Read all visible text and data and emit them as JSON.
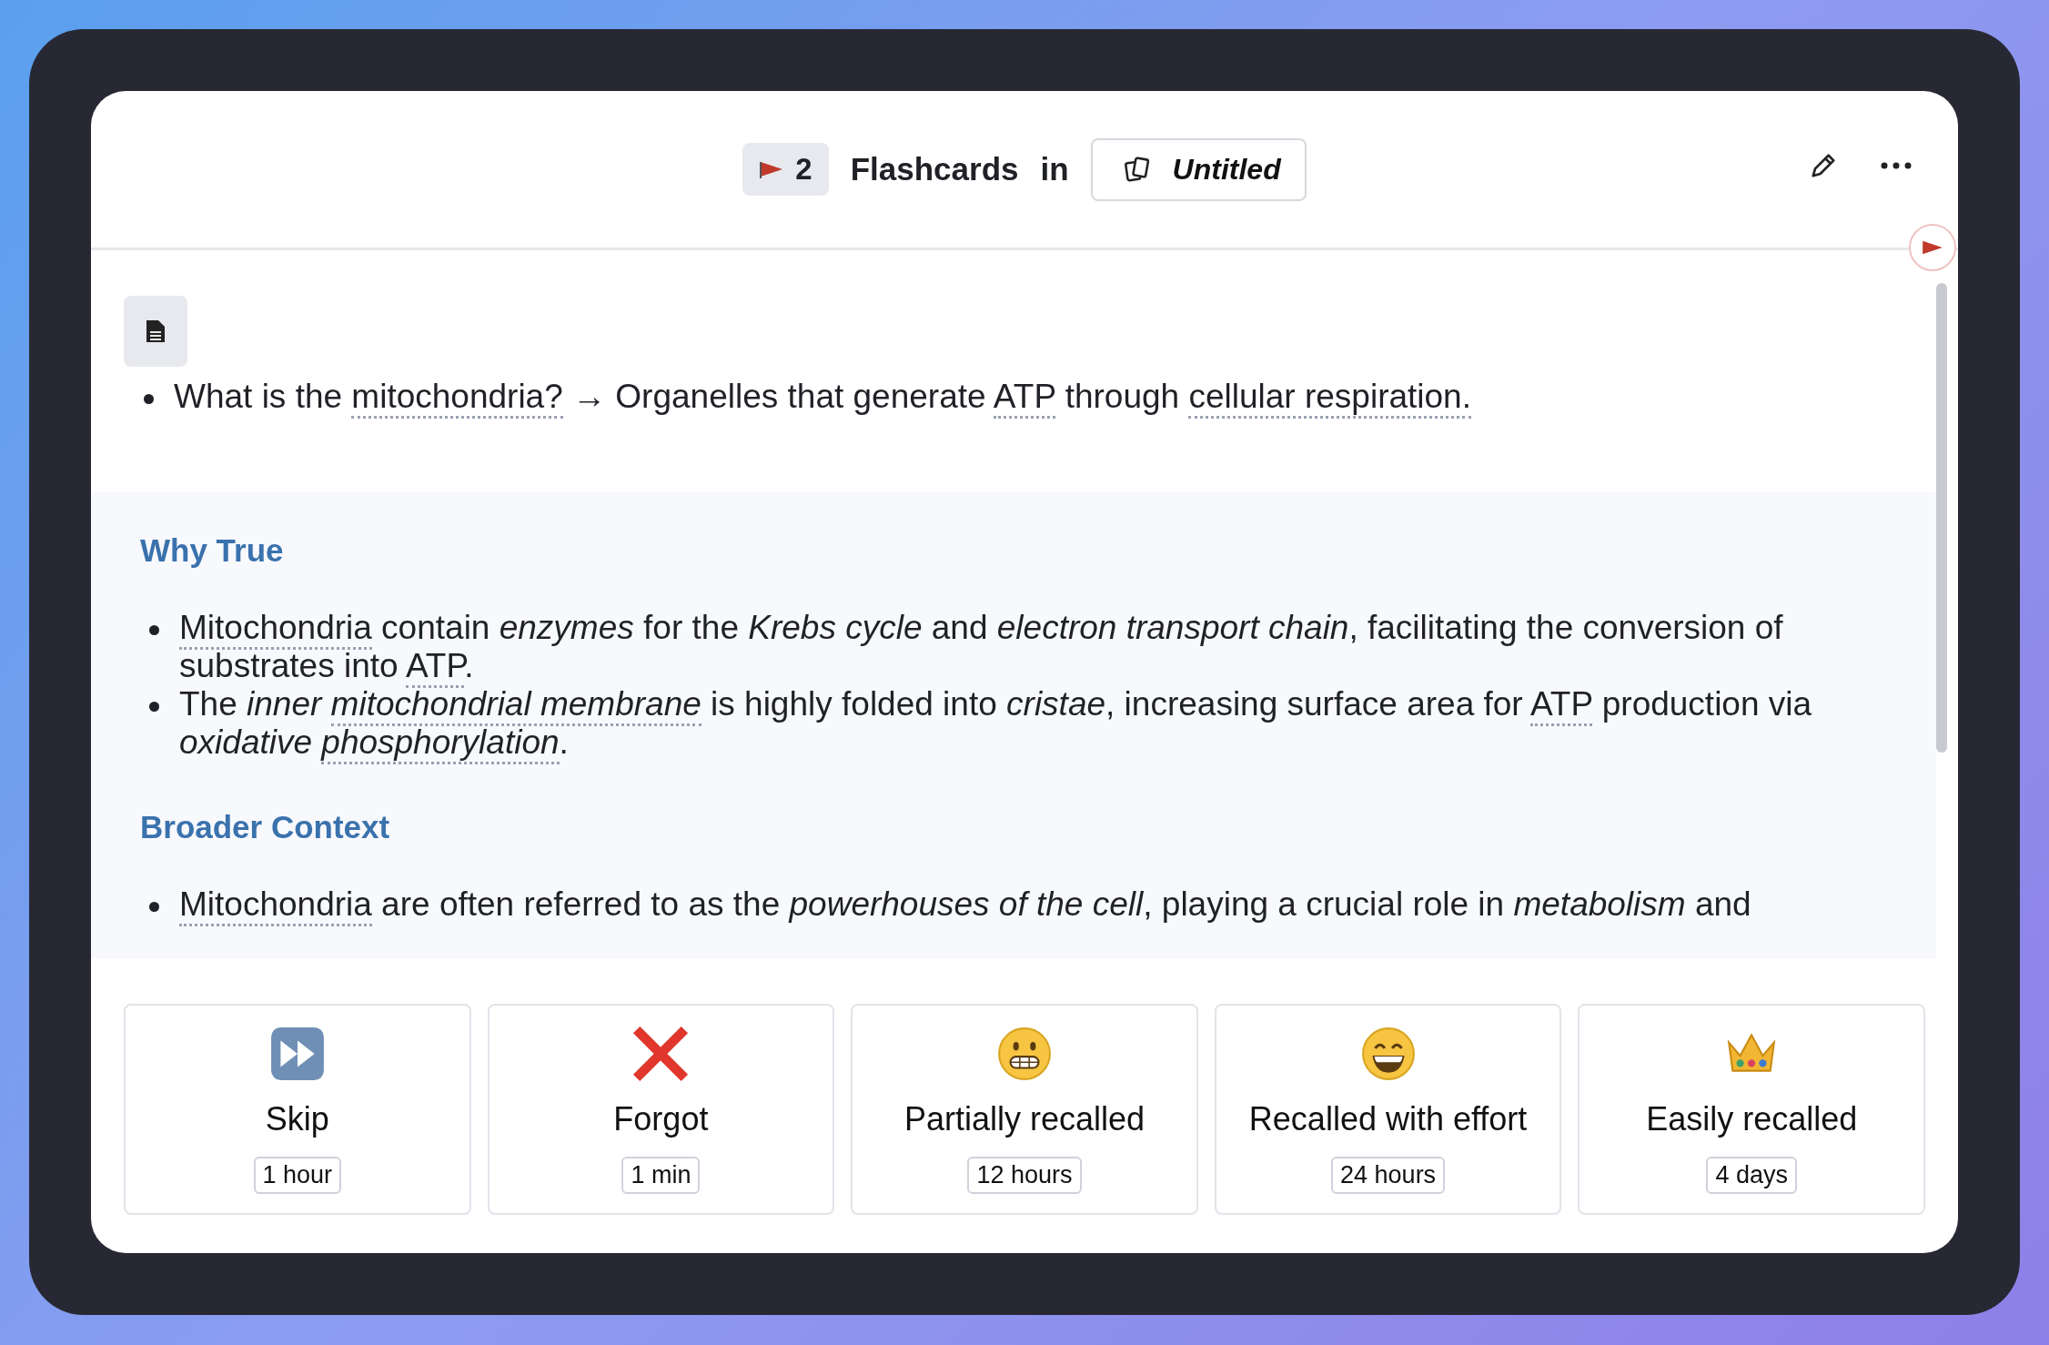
{
  "header": {
    "flag_count": "2",
    "title": "Flashcards",
    "connector": "in",
    "deck": "Untitled"
  },
  "question": [
    {
      "text": "What is the ",
      "italic": false,
      "term": false
    },
    {
      "text": "mitochondria?",
      "italic": false,
      "term": true
    },
    {
      "text": " → Organelles that generate ",
      "italic": false,
      "term": false
    },
    {
      "text": "ATP",
      "italic": false,
      "term": true
    },
    {
      "text": " through ",
      "italic": false,
      "term": false
    },
    {
      "text": "cellular respiration.",
      "italic": false,
      "term": true
    }
  ],
  "sections": [
    {
      "heading": "Why True",
      "bullets": [
        [
          {
            "text": "Mitochondria",
            "italic": false,
            "term": true
          },
          {
            "text": " contain ",
            "italic": false,
            "term": false
          },
          {
            "text": "enzymes",
            "italic": true,
            "term": false
          },
          {
            "text": " for the ",
            "italic": false,
            "term": false
          },
          {
            "text": "Krebs cycle",
            "italic": true,
            "term": false
          },
          {
            "text": " and ",
            "italic": false,
            "term": false
          },
          {
            "text": "electron transport chain",
            "italic": true,
            "term": false
          },
          {
            "text": ", facilitating the conversion of substrates into ",
            "italic": false,
            "term": false
          },
          {
            "text": "ATP",
            "italic": false,
            "term": true
          },
          {
            "text": ".",
            "italic": false,
            "term": false
          }
        ],
        [
          {
            "text": "The ",
            "italic": false,
            "term": false
          },
          {
            "text": "inner ",
            "italic": true,
            "term": false
          },
          {
            "text": "mitochondrial membrane",
            "italic": true,
            "term": true
          },
          {
            "text": " is highly folded into ",
            "italic": false,
            "term": false
          },
          {
            "text": "cristae",
            "italic": true,
            "term": false
          },
          {
            "text": ", increasing surface area for ",
            "italic": false,
            "term": false
          },
          {
            "text": "ATP",
            "italic": false,
            "term": true
          },
          {
            "text": " production via ",
            "italic": false,
            "term": false
          },
          {
            "text": "oxidative ",
            "italic": true,
            "term": false
          },
          {
            "text": "phosphorylation",
            "italic": true,
            "term": true
          },
          {
            "text": ".",
            "italic": false,
            "term": false
          }
        ]
      ]
    },
    {
      "heading": "Broader Context",
      "bullets": [
        [
          {
            "text": "Mitochondria",
            "italic": false,
            "term": true
          },
          {
            "text": " are often referred to as the ",
            "italic": false,
            "term": false
          },
          {
            "text": "powerhouses of the cell",
            "italic": true,
            "term": false
          },
          {
            "text": ", playing a crucial role in ",
            "italic": false,
            "term": false
          },
          {
            "text": "metabolism",
            "italic": true,
            "term": false
          },
          {
            "text": " and",
            "italic": false,
            "term": false
          }
        ]
      ]
    }
  ],
  "buttons": [
    {
      "kind": "skip",
      "label": "Skip",
      "interval": "1 hour"
    },
    {
      "kind": "forgot",
      "label": "Forgot",
      "interval": "1 min"
    },
    {
      "kind": "partial",
      "label": "Partially recalled",
      "interval": "12 hours"
    },
    {
      "kind": "effort",
      "label": "Recalled with effort",
      "interval": "24 hours"
    },
    {
      "kind": "easy",
      "label": "Easily recalled",
      "interval": "4 days"
    }
  ]
}
